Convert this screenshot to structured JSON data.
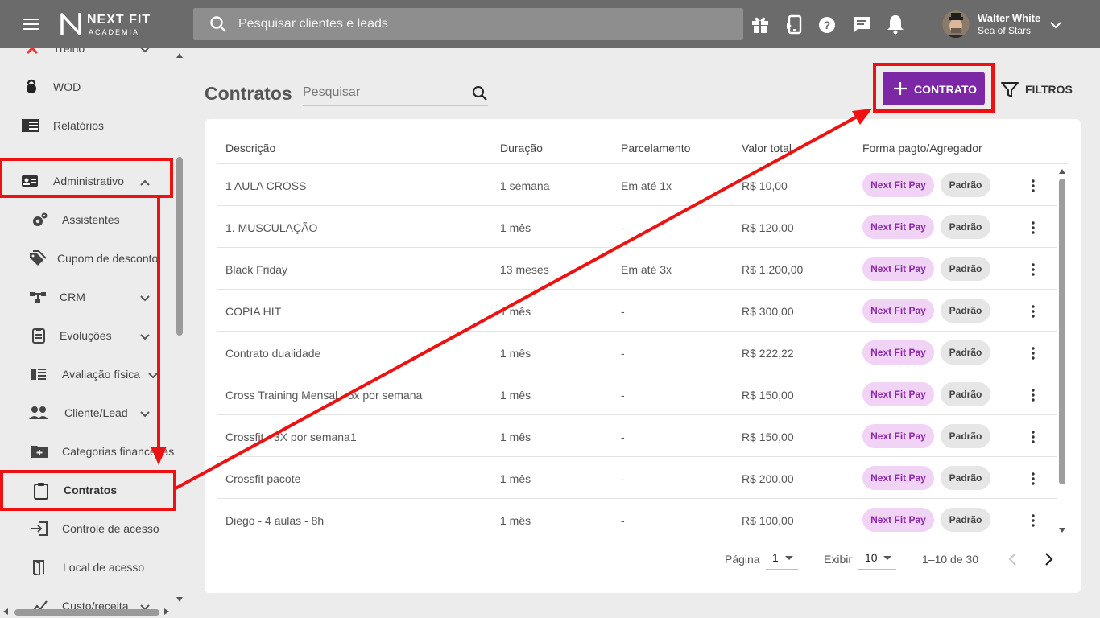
{
  "topbar": {
    "logo_text": "NEXT FIT",
    "logo_sub": "ACADEMIA",
    "search_placeholder": "Pesquisar clientes e leads",
    "user_name": "Walter White",
    "user_org": "Sea of Stars",
    "icons": [
      "menu-icon",
      "gift-icon",
      "phone-icon",
      "help-icon",
      "chat-icon",
      "bell-icon",
      "chevron-down-icon"
    ]
  },
  "sidebar": {
    "items": [
      {
        "label": "Treino",
        "icon": "treino-icon"
      },
      {
        "label": "WOD",
        "icon": "kettlebell-icon"
      },
      {
        "label": "Relatórios",
        "icon": "reports-icon"
      },
      {
        "label": "Administrativo",
        "icon": "id-card-icon"
      },
      {
        "label": "Assistentes",
        "icon": "gear-icon"
      },
      {
        "label": "Cupom de desconto",
        "icon": "tag-icon"
      },
      {
        "label": "CRM",
        "icon": "crm-icon"
      },
      {
        "label": "Evoluções",
        "icon": "clipboard-list-icon"
      },
      {
        "label": "Avaliação física",
        "icon": "assessment-icon"
      },
      {
        "label": "Cliente/Lead",
        "icon": "people-icon"
      },
      {
        "label": "Categorias financeiras",
        "icon": "folder-plus-icon"
      },
      {
        "label": "Contratos",
        "icon": "clipboard-icon"
      },
      {
        "label": "Controle de acesso",
        "icon": "login-icon"
      },
      {
        "label": "Local de acesso",
        "icon": "door-icon"
      },
      {
        "label": "Custo/receita",
        "icon": "cost-icon"
      }
    ]
  },
  "main": {
    "title": "Contratos",
    "search_placeholder": "Pesquisar",
    "add_button": "CONTRATO",
    "filters_button": "FILTROS",
    "columns": [
      "Descrição",
      "Duração",
      "Parcelamento",
      "Valor total",
      "Forma pagto/Agregador"
    ],
    "rows": [
      {
        "descricao": "1 AULA CROSS",
        "duracao": "1 semana",
        "parcelamento": "Em até 1x",
        "valor": "R$ 10,00",
        "pay": "Next Fit Pay",
        "agregador": "Padrão"
      },
      {
        "descricao": "1. MUSCULAÇÃO",
        "duracao": "1 mês",
        "parcelamento": "-",
        "valor": "R$ 120,00",
        "pay": "Next Fit Pay",
        "agregador": "Padrão"
      },
      {
        "descricao": "Black Friday",
        "duracao": "13 meses",
        "parcelamento": "Em até 3x",
        "valor": "R$ 1.200,00",
        "pay": "Next Fit Pay",
        "agregador": "Padrão"
      },
      {
        "descricao": "COPIA HIT",
        "duracao": "1 mês",
        "parcelamento": "-",
        "valor": "R$ 300,00",
        "pay": "Next Fit Pay",
        "agregador": "Padrão"
      },
      {
        "descricao": "Contrato dualidade",
        "duracao": "1 mês",
        "parcelamento": "-",
        "valor": "R$ 222,22",
        "pay": "Next Fit Pay",
        "agregador": "Padrão"
      },
      {
        "descricao": "Cross Training Mensal - 5x por semana",
        "duracao": "1 mês",
        "parcelamento": "-",
        "valor": "R$ 150,00",
        "pay": "Next Fit Pay",
        "agregador": "Padrão"
      },
      {
        "descricao": "Crossfit - 3X por semana1",
        "duracao": "1 mês",
        "parcelamento": "-",
        "valor": "R$ 150,00",
        "pay": "Next Fit Pay",
        "agregador": "Padrão"
      },
      {
        "descricao": "Crossfit pacote",
        "duracao": "1 mês",
        "parcelamento": "-",
        "valor": "R$ 200,00",
        "pay": "Next Fit Pay",
        "agregador": "Padrão"
      },
      {
        "descricao": "Diego - 4 aulas - 8h",
        "duracao": "1 mês",
        "parcelamento": "-",
        "valor": "R$ 100,00",
        "pay": "Next Fit Pay",
        "agregador": "Padrão"
      }
    ],
    "pagination": {
      "page_label": "Página",
      "page_value": "1",
      "show_label": "Exibir",
      "show_value": "10",
      "range": "1–10 de 30"
    }
  },
  "colors": {
    "topbar": "#6b6b6b",
    "accent": "#7b27a6",
    "chip_pay_bg": "#f0d3f5",
    "annotation": "#ee1111"
  }
}
